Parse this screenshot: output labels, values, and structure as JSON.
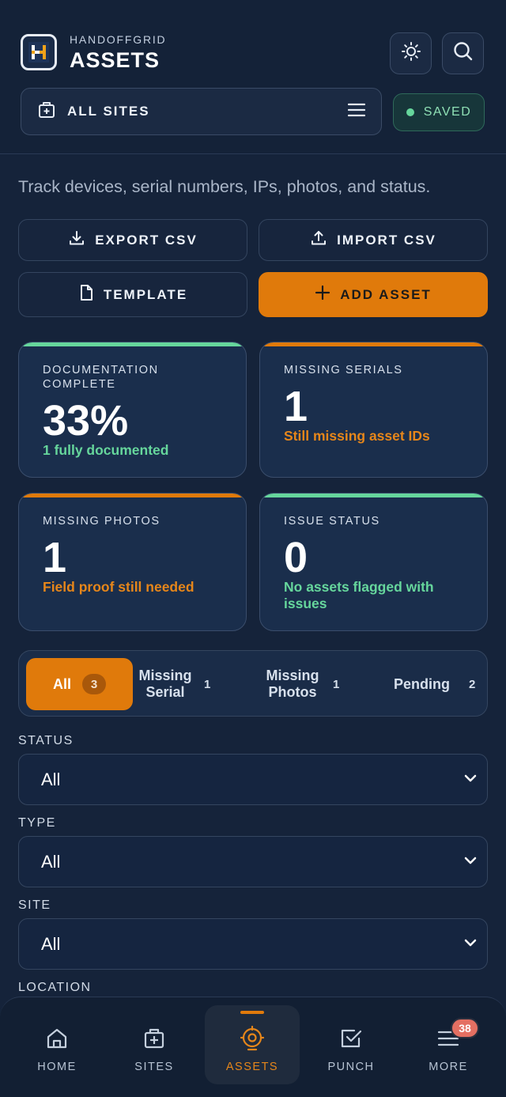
{
  "header": {
    "brand_sub": "HANDOFFGRID",
    "title": "ASSETS",
    "site_selector": "ALL SITES",
    "saved_status": "SAVED"
  },
  "intro": "Track devices, serial numbers, IPs, photos, and status.",
  "actions": {
    "export": "EXPORT CSV",
    "import": "IMPORT CSV",
    "template": "TEMPLATE",
    "add": "ADD ASSET"
  },
  "stats": [
    {
      "title": "DOCUMENTATION COMPLETE",
      "value": "33%",
      "sub": "1 fully documented"
    },
    {
      "title": "MISSING SERIALS",
      "value": "1",
      "sub": "Still missing asset IDs"
    },
    {
      "title": "MISSING PHOTOS",
      "value": "1",
      "sub": "Field proof still needed"
    },
    {
      "title": "ISSUE STATUS",
      "value": "0",
      "sub": "No assets flagged with issues"
    }
  ],
  "filter_tabs": [
    {
      "label": "All",
      "count": "3"
    },
    {
      "label": "Missing Serial",
      "count": "1"
    },
    {
      "label": "Missing Photos",
      "count": "1"
    },
    {
      "label": "Pending",
      "count": "2"
    }
  ],
  "filters": {
    "status_label": "STATUS",
    "status_value": "All",
    "type_label": "TYPE",
    "type_value": "All",
    "site_label": "SITE",
    "site_value": "All",
    "location_label": "LOCATION"
  },
  "nav": {
    "home": "HOME",
    "sites": "SITES",
    "assets": "ASSETS",
    "punch": "PUNCH",
    "more": "MORE",
    "more_badge": "38"
  },
  "colors": {
    "accent": "#e07a0b",
    "success": "#66d69c",
    "background": "#15233a"
  }
}
